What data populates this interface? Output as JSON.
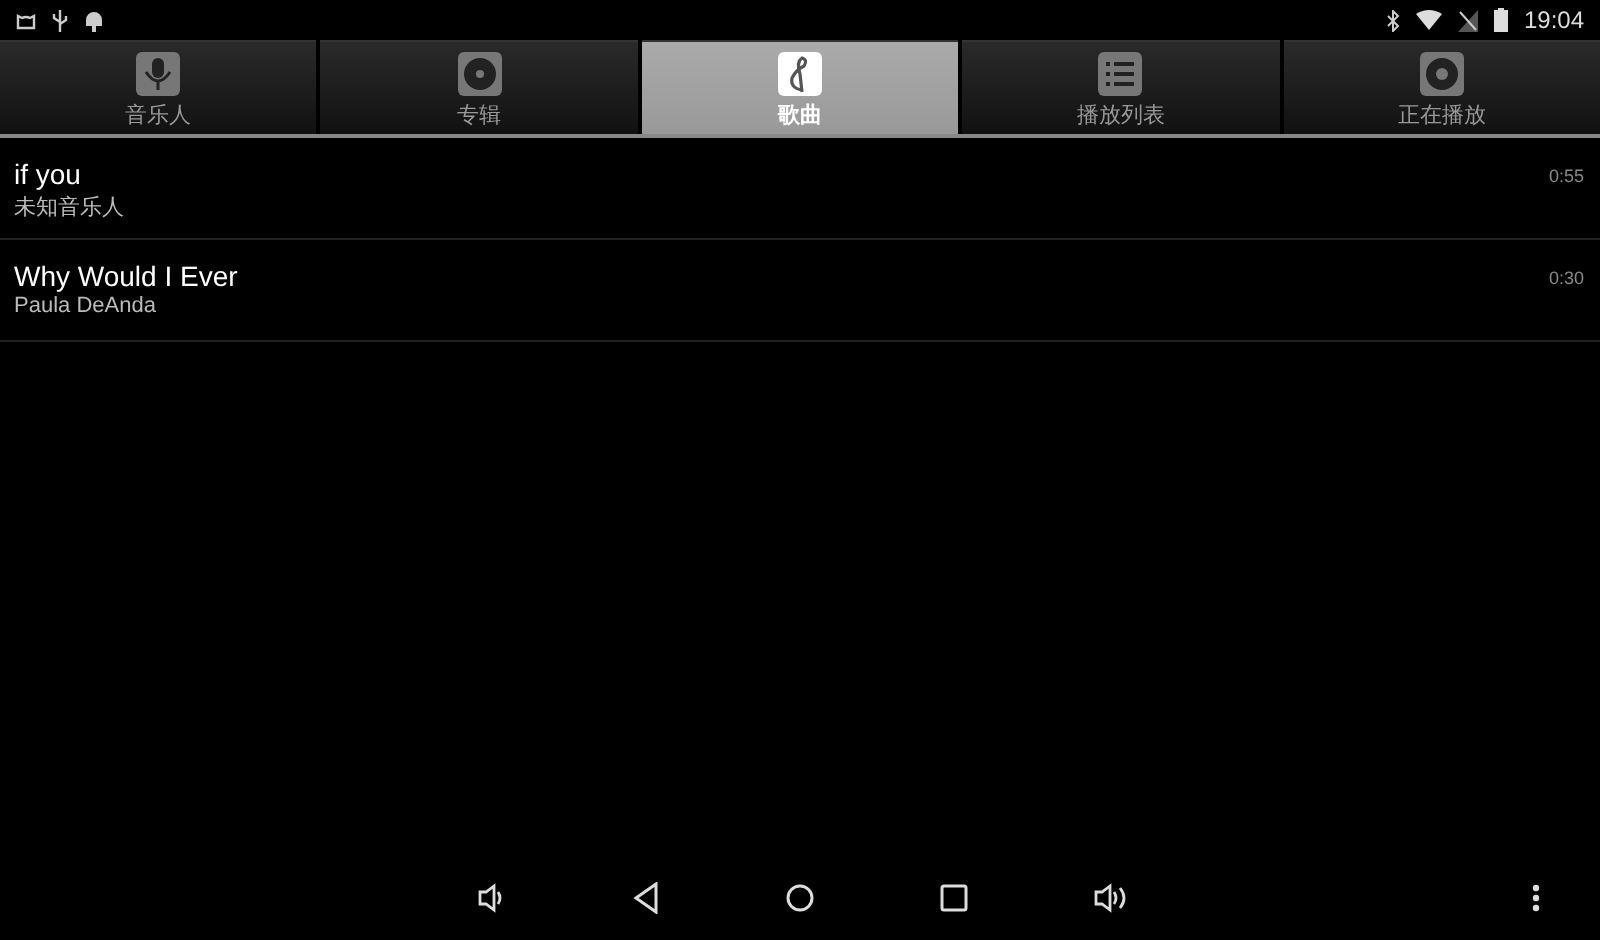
{
  "status_bar": {
    "time": "19:04"
  },
  "tabs": [
    {
      "label": "音乐人",
      "selected": false
    },
    {
      "label": "专辑",
      "selected": false
    },
    {
      "label": "歌曲",
      "selected": true
    },
    {
      "label": "播放列表",
      "selected": false
    },
    {
      "label": "正在播放",
      "selected": false
    }
  ],
  "songs": [
    {
      "title": "if you",
      "artist": "未知音乐人",
      "duration": "0:55"
    },
    {
      "title": "Why Would I Ever",
      "artist": "Paula DeAnda",
      "duration": "0:30"
    }
  ]
}
